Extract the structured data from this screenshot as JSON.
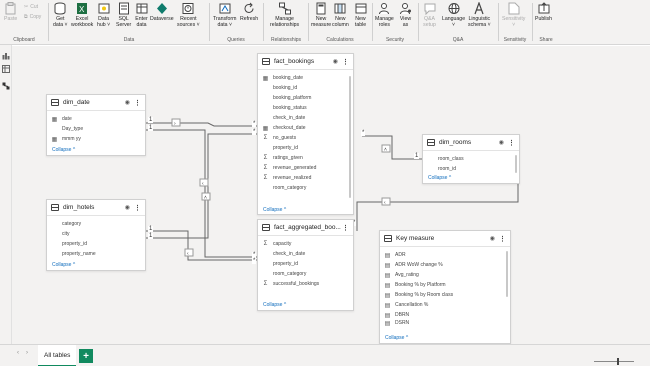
{
  "ribbon": {
    "clipboard": {
      "label": "Clipboard",
      "paste": "Paste",
      "cut": "Cut",
      "copy": "Copy"
    },
    "data": {
      "label": "Data",
      "get_data": [
        "Get",
        "data ˅"
      ],
      "excel": [
        "Excel",
        "workbook"
      ],
      "data_hub": [
        "Data",
        "hub ˅"
      ],
      "sql": [
        "SQL",
        "Server"
      ],
      "enter_data": [
        "Enter",
        "data"
      ],
      "dataverse": [
        "Dataverse"
      ],
      "recent_sources": [
        "Recent",
        "sources ˅"
      ]
    },
    "queries": {
      "label": "Queries",
      "transform": [
        "Transform",
        "data ˅"
      ],
      "refresh": [
        "Refresh"
      ]
    },
    "relationships": {
      "label": "Relationships",
      "manage": [
        "Manage",
        "relationships"
      ]
    },
    "calculations": {
      "label": "Calculations",
      "new_measure": [
        "New",
        "measure"
      ],
      "new_column": [
        "New",
        "column"
      ],
      "new_table": [
        "New",
        "table"
      ]
    },
    "security": {
      "label": "Security",
      "manage_roles": [
        "Manage",
        "roles"
      ],
      "view_as": [
        "View",
        "as"
      ]
    },
    "qa": {
      "label": "Q&A",
      "qa_setup": [
        "Q&A",
        "setup"
      ],
      "language": [
        "Language",
        "˅"
      ],
      "linguistic": [
        "Linguistic",
        "schema ˅"
      ]
    },
    "sensitivity": {
      "label": "Sensitivity",
      "sensitivity": [
        "Sensitivity",
        "˅"
      ]
    },
    "share": {
      "label": "Share",
      "publish": [
        "Publish"
      ]
    }
  },
  "tables": {
    "fact_bookings": {
      "title": "fact_bookings",
      "fields": [
        {
          "name": "booking_date",
          "icon": "calendar-icon"
        },
        {
          "name": "booking_id",
          "icon": "none"
        },
        {
          "name": "booking_platform",
          "icon": "none"
        },
        {
          "name": "booking_status",
          "icon": "none"
        },
        {
          "name": "check_in_date",
          "icon": "none"
        },
        {
          "name": "checkout_date",
          "icon": "calendar-icon"
        },
        {
          "name": "no_guests",
          "icon": "sigma-icon"
        },
        {
          "name": "property_id",
          "icon": "none"
        },
        {
          "name": "ratings_given",
          "icon": "sigma-icon"
        },
        {
          "name": "revenue_generated",
          "icon": "sigma-icon"
        },
        {
          "name": "revenue_realized",
          "icon": "sigma-icon"
        },
        {
          "name": "room_category",
          "icon": "none"
        }
      ],
      "collapse": "Collapse ^"
    },
    "dim_date": {
      "title": "dim_date",
      "fields": [
        {
          "name": "date",
          "icon": "calendar-icon"
        },
        {
          "name": "Day_type",
          "icon": "none"
        },
        {
          "name": "mmm yy",
          "icon": "calendar-icon"
        }
      ],
      "collapse": "Collapse ^"
    },
    "dim_rooms": {
      "title": "dim_rooms",
      "fields": [
        {
          "name": "room_class",
          "icon": "none"
        },
        {
          "name": "room_id",
          "icon": "none"
        }
      ],
      "collapse": "Collapse ^"
    },
    "dim_hotels": {
      "title": "dim_hotels",
      "fields": [
        {
          "name": "category",
          "icon": "none"
        },
        {
          "name": "city",
          "icon": "none"
        },
        {
          "name": "property_id",
          "icon": "none"
        },
        {
          "name": "property_name",
          "icon": "none"
        }
      ],
      "collapse": "Collapse ^"
    },
    "fact_aggregated": {
      "title": "fact_aggregated_boo...",
      "fields": [
        {
          "name": "capacity",
          "icon": "sigma-icon"
        },
        {
          "name": "check_in_date",
          "icon": "none"
        },
        {
          "name": "property_id",
          "icon": "none"
        },
        {
          "name": "room_category",
          "icon": "none"
        },
        {
          "name": "successful_bookings",
          "icon": "sigma-icon"
        }
      ],
      "collapse": "Collapse ^"
    },
    "key_measure": {
      "title": "Key measure",
      "fields": [
        {
          "name": "ADR",
          "icon": "measure-icon"
        },
        {
          "name": "ADR WoW change %",
          "icon": "measure-icon"
        },
        {
          "name": "Avg_rating",
          "icon": "measure-icon"
        },
        {
          "name": "Booking % by Platform",
          "icon": "measure-icon"
        },
        {
          "name": "Booking % by Room class",
          "icon": "measure-icon"
        },
        {
          "name": "Cancellation %",
          "icon": "measure-icon"
        },
        {
          "name": "DBRN",
          "icon": "measure-icon"
        },
        {
          "name": "DSRN",
          "icon": "measure-icon"
        }
      ],
      "collapse": "Collapse ^"
    }
  },
  "relationship_labels": {
    "one": "1",
    "many": "*"
  },
  "bottom": {
    "tab_all_tables": "All tables",
    "add_tab": "+"
  }
}
